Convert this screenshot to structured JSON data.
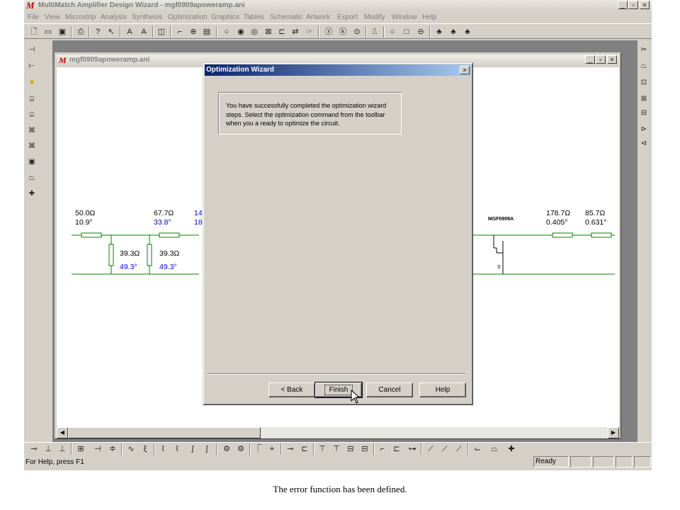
{
  "app": {
    "title": "MultiMatch Amplifier Design Wizard - mgf0909apoweramp.ani",
    "logo": "M",
    "caption_buttons": [
      "_",
      "▫",
      "×"
    ]
  },
  "menu": [
    "File",
    "View",
    "Microstrip",
    "Analysis",
    "Synthesis",
    "Optimization",
    "Graphics",
    "Tables",
    "Schematic",
    "Artwork",
    "Export",
    "Modify",
    "Window",
    "Help"
  ],
  "toolbar": {
    "icons": [
      "new-icon",
      "open-icon",
      "save-icon",
      "print-icon",
      "help-icon",
      "context-help-icon",
      "zoom-in-icon",
      "zoom-out-icon",
      "fit-icon",
      "probe-icon",
      "component-icon",
      "list-icon",
      "circle-icon",
      "circle-marker-icon",
      "target-icon",
      "box-x-icon",
      "split-icon",
      "swap-icon",
      "hand-icon",
      "y-icon",
      "k-icon",
      "dot-icon",
      "pulse-icon",
      "circle-big-icon",
      "square-icon",
      "minus-circle-icon",
      "tool-a-icon",
      "tool-b-icon",
      "tool-c-icon"
    ]
  },
  "child_window": {
    "title": "mgf0909apoweramp.ani",
    "caption_buttons": [
      "_",
      "▫",
      "×"
    ]
  },
  "circuit": {
    "labels": [
      {
        "name": "tl1-impedance",
        "text": "50.0Ω",
        "blue": false
      },
      {
        "name": "tl1-length",
        "text": "10.9°",
        "blue": false
      },
      {
        "name": "tl2-impedance",
        "text": "67.7Ω",
        "blue": false
      },
      {
        "name": "tl2-length",
        "text": "33.8°",
        "blue": true
      },
      {
        "name": "tl3-impedance-partial",
        "text": "14",
        "blue": true
      },
      {
        "name": "tl3-length-partial",
        "text": "18",
        "blue": true
      },
      {
        "name": "stub1-impedance",
        "text": "39.3Ω",
        "blue": false
      },
      {
        "name": "stub1-length",
        "text": "49.3°",
        "blue": true
      },
      {
        "name": "stub2-impedance",
        "text": "39.3Ω",
        "blue": false
      },
      {
        "name": "stub2-length",
        "text": "49.3°",
        "blue": true
      },
      {
        "name": "tl4-impedance",
        "text": "178.7Ω",
        "blue": false
      },
      {
        "name": "tl4-length",
        "text": "0.405°",
        "blue": false
      },
      {
        "name": "tl5-impedance",
        "text": "85.7Ω",
        "blue": false
      },
      {
        "name": "tl5-length",
        "text": "0.631°",
        "blue": false
      }
    ],
    "device_label": "MGF0909A",
    "source_label": "S"
  },
  "dialog": {
    "title": "Optimization Wizard",
    "close": "×",
    "message": "You have successfully completed the optimization wizard steps. Select the optimization command from the toolbar when you a ready to optimize the circuit.",
    "buttons": {
      "back": "< Back",
      "finish": "Finish",
      "cancel": "Cancel",
      "help": "Help"
    }
  },
  "status": {
    "help_text": "For Help, press F1",
    "ready": "Ready"
  },
  "caption": "The error function has been defined.",
  "colors": {
    "chrome": "#d4d0c8",
    "dialog_title": "#0a246a",
    "wire": "#008000",
    "value_blue": "#0000cc"
  }
}
